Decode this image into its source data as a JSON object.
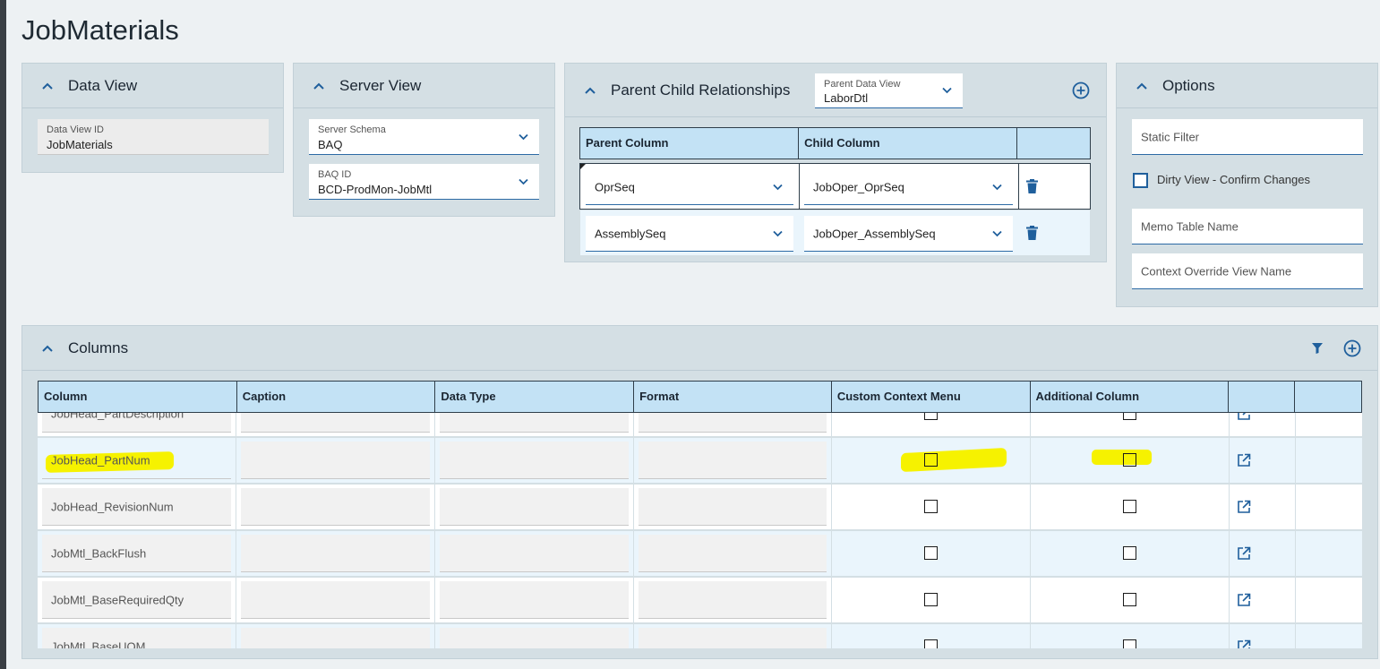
{
  "page": {
    "title": "JobMaterials"
  },
  "data_view": {
    "title": "Data View",
    "id_label": "Data View ID",
    "id_value": "JobMaterials"
  },
  "server_view": {
    "title": "Server View",
    "schema_label": "Server Schema",
    "schema_value": "BAQ",
    "baq_label": "BAQ ID",
    "baq_value": "BCD-ProdMon-JobMtl"
  },
  "parent_child": {
    "title": "Parent Child Relationships",
    "parent_view_label": "Parent Data View",
    "parent_view_value": "LaborDtl",
    "headers": [
      "Parent Column",
      "Child Column",
      ""
    ],
    "rows": [
      {
        "parent": "OprSeq",
        "child": "JobOper_OprSeq"
      },
      {
        "parent": "AssemblySeq",
        "child": "JobOper_AssemblySeq"
      }
    ]
  },
  "options": {
    "title": "Options",
    "static_filter": "Static Filter",
    "dirty_view": "Dirty View - Confirm Changes",
    "memo_table": "Memo Table Name",
    "context_override": "Context Override View Name"
  },
  "columns": {
    "title": "Columns",
    "headers": [
      "Column",
      "Caption",
      "Data Type",
      "Format",
      "Custom Context Menu",
      "Additional Column",
      "",
      ""
    ],
    "rows": [
      {
        "column": "JobHead_PartDescription"
      },
      {
        "column": "JobHead_PartNum"
      },
      {
        "column": "JobHead_RevisionNum"
      },
      {
        "column": "JobMtl_BackFlush"
      },
      {
        "column": "JobMtl_BaseRequiredQty"
      },
      {
        "column": "JobMtl_BaseUOM"
      }
    ]
  },
  "colors": {
    "accent": "#1f5f9c",
    "highlight": "#f6f200",
    "card_bg": "#d4dfe4",
    "header_bg": "#c3e2f5"
  }
}
